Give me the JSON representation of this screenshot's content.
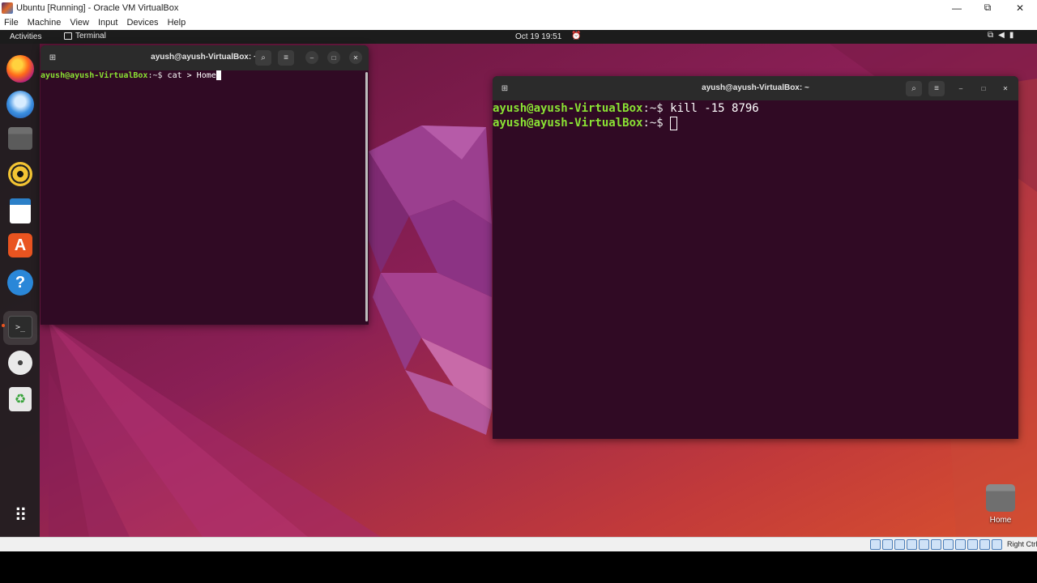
{
  "vbox": {
    "window_title": "Ubuntu [Running] - Oracle VM VirtualBox",
    "controls": {
      "minimize": "—",
      "restore": "⧉",
      "close": "✕"
    },
    "menu": [
      "File",
      "Machine",
      "View",
      "Input",
      "Devices",
      "Help"
    ],
    "host_key": "Right Ctrl"
  },
  "topbar": {
    "activities": "Activities",
    "app_name": "Terminal",
    "clock": "Oct 19  19:51",
    "bell_icon": "alarm-bell-icon",
    "status_icons": [
      "network-icon",
      "volume-icon",
      "battery-icon"
    ]
  },
  "dock": {
    "items": [
      "firefox",
      "thunderbird",
      "files",
      "rhythmbox",
      "libreoffice-writer",
      "app-center",
      "help",
      "terminal",
      "disc",
      "trash",
      "show-apps"
    ]
  },
  "term_left": {
    "title": "ayush@ayush-VirtualBox: ~",
    "prompt_user": "ayush@ayush-VirtualBox",
    "prompt_sep": ":~$ ",
    "command": "cat > Home"
  },
  "term_right": {
    "title": "ayush@ayush-VirtualBox: ~",
    "lines": [
      {
        "prompt_user": "ayush@ayush-VirtualBox",
        "prompt_sep": ":~$ ",
        "command": "kill -15 8796"
      },
      {
        "prompt_user": "ayush@ayush-VirtualBox",
        "prompt_sep": ":~$ ",
        "command": ""
      }
    ]
  },
  "desktop": {
    "home_label": "Home"
  },
  "colors": {
    "terminal_bg": "#300a24",
    "prompt_green": "#8ae234",
    "ubuntu_orange": "#e95420"
  }
}
